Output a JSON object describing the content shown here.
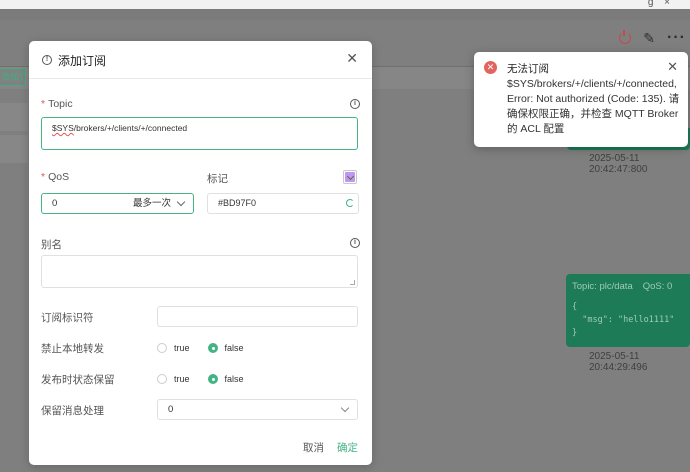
{
  "window": {
    "corner_glyphs": "g ×"
  },
  "background": {
    "tab_label": "添加订阅",
    "message_timestamp_1": "2025-05-11 20:42:47:800",
    "message": {
      "topic_label": "Topic: plc/data",
      "qos_label": "QoS: 0",
      "payload_lines": [
        "{",
        "  \"msg\": \"hello1111\"",
        "}"
      ]
    },
    "message_timestamp_2": "2025-05-11 20:44:29:496",
    "colors": {
      "accent": "#1d7b57"
    }
  },
  "modal": {
    "title": "添加订阅",
    "topic": {
      "label": "Topic",
      "sys_part": "$SYS",
      "rest": "/brokers/+/clients/+/connected"
    },
    "qos": {
      "label": "QoS",
      "value": "0",
      "description": "最多一次"
    },
    "color": {
      "label": "标记",
      "value": "#BD97F0"
    },
    "alias": {
      "label": "别名"
    },
    "sub_id": {
      "label": "订阅标识符"
    },
    "no_local": {
      "label": "禁止本地转发",
      "option_true": "true",
      "option_false": "false",
      "selected": "false"
    },
    "retain_as_published": {
      "label": "发布时状态保留",
      "option_true": "true",
      "option_false": "false",
      "selected": "false"
    },
    "retain_handling": {
      "label": "保留消息处理",
      "value": "0"
    },
    "buttons": {
      "cancel": "取消",
      "confirm": "确定"
    },
    "colors": {
      "accent": "#45b485",
      "required": "#e05555"
    }
  },
  "toast": {
    "title": "无法订阅",
    "message": "$SYS/brokers/+/clients/+/connected, Error: Not authorized (Code: 135). 请确保权限正确，并检查 MQTT Broker 的 ACL 配置",
    "colors": {
      "error": "#e2645e"
    }
  }
}
